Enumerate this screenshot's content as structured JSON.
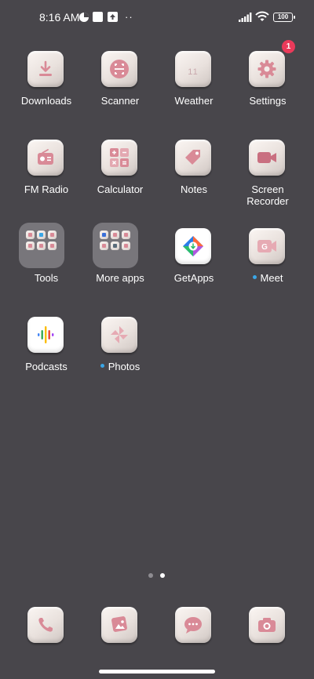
{
  "status_bar": {
    "time": "8:16 AM",
    "battery": "100",
    "more": "··"
  },
  "apps": [
    {
      "label": "Downloads",
      "icon": "download-icon"
    },
    {
      "label": "Scanner",
      "icon": "scanner-icon"
    },
    {
      "label": "Weather",
      "icon": "weather-icon",
      "tile_text": "11"
    },
    {
      "label": "Settings",
      "icon": "gear-icon",
      "badge": "1"
    },
    {
      "label": "FM Radio",
      "icon": "radio-icon"
    },
    {
      "label": "Calculator",
      "icon": "calculator-icon"
    },
    {
      "label": "Notes",
      "icon": "tag-icon"
    },
    {
      "label_line1": "Screen",
      "label_line2": "Recorder",
      "icon": "video-camera-icon"
    },
    {
      "label": "Tools",
      "icon": "folder-icon"
    },
    {
      "label": "More apps",
      "icon": "folder-icon"
    },
    {
      "label": "GetApps",
      "icon": "getapps-icon"
    },
    {
      "label": "Meet",
      "icon": "meet-icon",
      "new_dot": true
    },
    {
      "label": "Podcasts",
      "icon": "podcasts-icon"
    },
    {
      "label": "Photos",
      "icon": "pinwheel-icon",
      "new_dot": true
    }
  ],
  "dock": [
    {
      "icon": "phone-icon"
    },
    {
      "icon": "gallery-icon"
    },
    {
      "icon": "message-icon"
    },
    {
      "icon": "camera-icon"
    }
  ],
  "pages": {
    "count": 2,
    "current": 2
  },
  "colors": {
    "background": "#48464b",
    "icon_pink": "#d98a97",
    "badge": "#ea3a5a",
    "new_dot": "#3aa6e6"
  }
}
